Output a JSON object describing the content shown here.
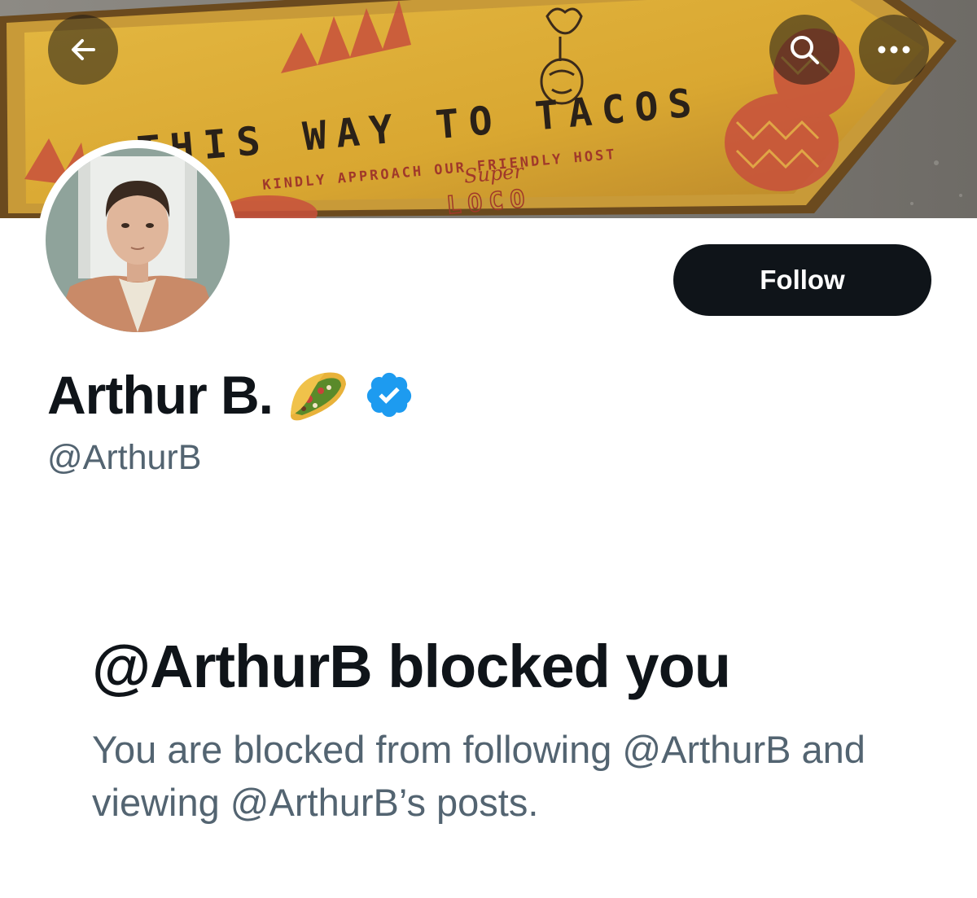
{
  "header": {
    "banner_sign": {
      "headline": "THIS WAY TO TACOS",
      "subline": "KINDLY APPROACH OUR FRIENDLY HOST",
      "script_text": "Super",
      "brand": "LOCO"
    },
    "back_icon": "arrow-left-icon",
    "search_icon": "search-icon",
    "more_icon": "more-dots-icon"
  },
  "profile": {
    "display_name": "Arthur B.",
    "emoji": "taco-emoji",
    "handle": "@ArthurB",
    "verified": true,
    "follow_label": "Follow"
  },
  "block_notice": {
    "title": "@ArthurB blocked you",
    "description": "You are blocked from following @ArthurB and viewing @ArthurB’s posts."
  },
  "colors": {
    "primary_text": "#0f1419",
    "secondary_text": "#536471",
    "follow_button": "#0f1419",
    "verified_badge": "#1d9bf0"
  }
}
